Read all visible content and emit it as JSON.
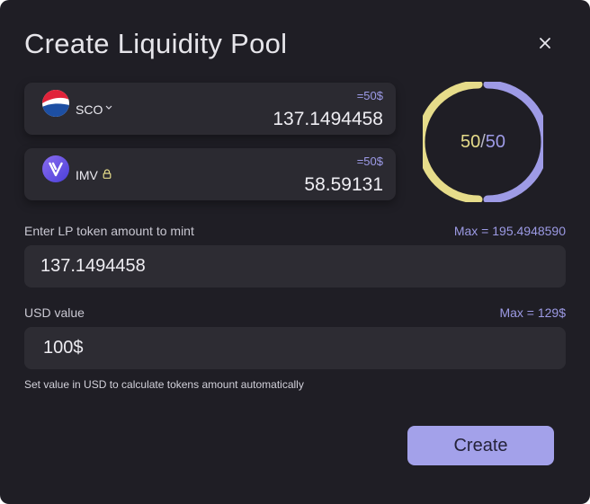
{
  "modal": {
    "title": "Create Liquidity Pool"
  },
  "tokens": [
    {
      "symbol": "SCO",
      "usd": "=50$",
      "amount": "137.1494458",
      "icon": "pepsi-logo-icon",
      "control": "chevron-down-icon"
    },
    {
      "symbol": "IMV",
      "usd": "=50$",
      "amount": "58.59131",
      "icon": "imv-token-logo-icon",
      "control": "lock-icon"
    }
  ],
  "ratio": {
    "left": "50",
    "sep": "/",
    "right": "50",
    "left_color": "#e6dc8a",
    "right_color": "#9e9be6"
  },
  "lp": {
    "label": "Enter LP token amount to mint",
    "max": "Max = 195.4948590",
    "value": "137.1494458"
  },
  "usd": {
    "label": "USD value",
    "max": "Max = 129$",
    "value": "100$",
    "hint": "Set value in USD to calculate tokens amount automatically"
  },
  "actions": {
    "create": "Create"
  },
  "colors": {
    "background": "#1f1e25",
    "card": "#2b2a31",
    "accent": "#a3a1ea"
  }
}
